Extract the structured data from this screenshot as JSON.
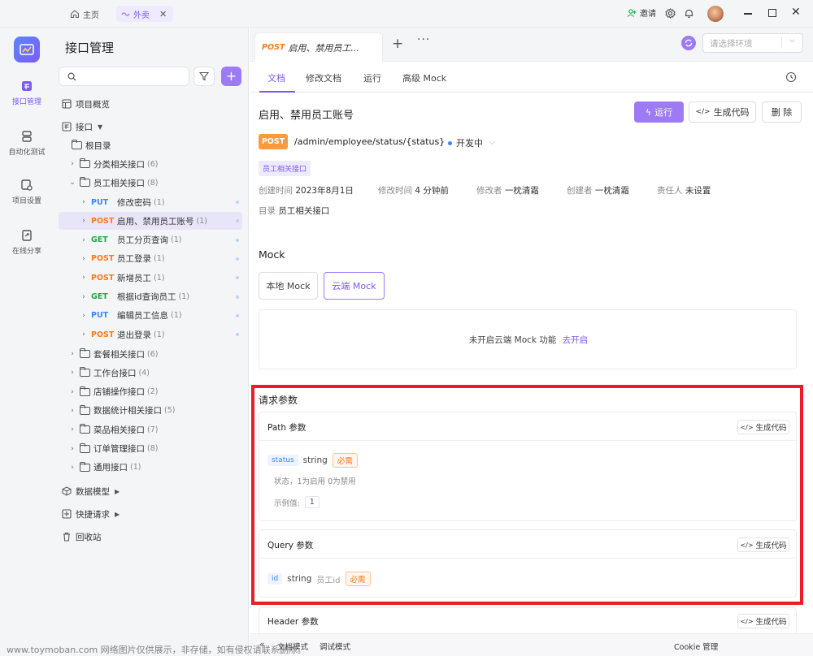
{
  "titlebar": {
    "home_label": "主页",
    "project_tab": "外卖",
    "invite_label": "邀请"
  },
  "rail": {
    "items": [
      {
        "label": "接口管理"
      },
      {
        "label": "自动化测试"
      },
      {
        "label": "项目设置"
      },
      {
        "label": "在线分享"
      }
    ]
  },
  "sidebar": {
    "title": "接口管理",
    "overview": "项目概览",
    "api_root": "接口",
    "root_dir": "根目录",
    "folders_top": [
      {
        "name": "分类相关接口",
        "count": "(6)"
      },
      {
        "name": "员工相关接口",
        "count": "(8)"
      }
    ],
    "apis": [
      {
        "method": "PUT",
        "name": "修改密码",
        "count": "(1)"
      },
      {
        "method": "POST",
        "name": "启用、禁用员工账号",
        "count": "(1)"
      },
      {
        "method": "GET",
        "name": "员工分页查询",
        "count": "(1)"
      },
      {
        "method": "POST",
        "name": "员工登录",
        "count": "(1)"
      },
      {
        "method": "POST",
        "name": "新增员工",
        "count": "(1)"
      },
      {
        "method": "GET",
        "name": "根据id查询员工",
        "count": "(1)"
      },
      {
        "method": "PUT",
        "name": "编辑员工信息",
        "count": "(1)"
      },
      {
        "method": "POST",
        "name": "退出登录",
        "count": "(1)"
      }
    ],
    "folders_bottom": [
      {
        "name": "套餐相关接口",
        "count": "(6)"
      },
      {
        "name": "工作台接口",
        "count": "(4)"
      },
      {
        "name": "店铺操作接口",
        "count": "(2)"
      },
      {
        "name": "数据统计相关接口",
        "count": "(5)"
      },
      {
        "name": "菜品相关接口",
        "count": "(7)"
      },
      {
        "name": "订单管理接口",
        "count": "(8)"
      },
      {
        "name": "通用接口",
        "count": "(1)"
      }
    ],
    "data_model": "数据模型",
    "quick_request": "快捷请求",
    "trash": "回收站"
  },
  "main": {
    "tab_method": "POST",
    "tab_title": "启用、禁用员工...",
    "env_placeholder": "请选择环境",
    "subtabs": [
      "文档",
      "修改文档",
      "运行",
      "高级 Mock"
    ],
    "api_title": "启用、禁用员工账号",
    "run_label": "运行",
    "gencode_label": "生成代码",
    "delete_label": "删 除",
    "method": "POST",
    "path": "/admin/employee/status/{status}",
    "status": "开发中",
    "tag": "员工相关接口",
    "meta": {
      "created_label": "创建时间",
      "created": "2023年8月1日",
      "modified_label": "修改时间",
      "modified": "4 分钟前",
      "modifier_label": "修改者",
      "modifier": "一枕清霜",
      "creator_label": "创建者",
      "creator": "一枕清霜",
      "owner_label": "责任人",
      "owner": "未设置",
      "dir_label": "目录",
      "dir": "员工相关接口"
    },
    "mock": {
      "heading": "Mock",
      "local_tab": "本地 Mock",
      "cloud_tab": "云端 Mock",
      "notice": "未开启云端 Mock 功能",
      "enable_link": "去开启"
    },
    "request": {
      "heading": "请求参数",
      "path_section": "Path 参数",
      "path_param": {
        "name": "status",
        "type": "string",
        "required": "必需",
        "desc": "状态，1为启用 0为禁用",
        "example_label": "示例值:",
        "example": "1"
      },
      "query_section": "Query 参数",
      "query_param": {
        "name": "id",
        "type": "string",
        "desc": "员工id",
        "required": "必需"
      },
      "header_section": "Header 参数",
      "gencode": "生成代码"
    }
  },
  "footer": {
    "doc_mode": "文档模式",
    "debug_mode": "调试模式",
    "cookie": "Cookie 管理"
  },
  "watermark": "www.toymoban.com 网络图片仅供展示，非存储，如有侵权请联系删除。",
  "colors": {
    "accent": "#7b5bf2",
    "post": "#ff9a3c",
    "get": "#26a64a",
    "put": "#3a86ff",
    "highlight": "#ea1c24"
  }
}
